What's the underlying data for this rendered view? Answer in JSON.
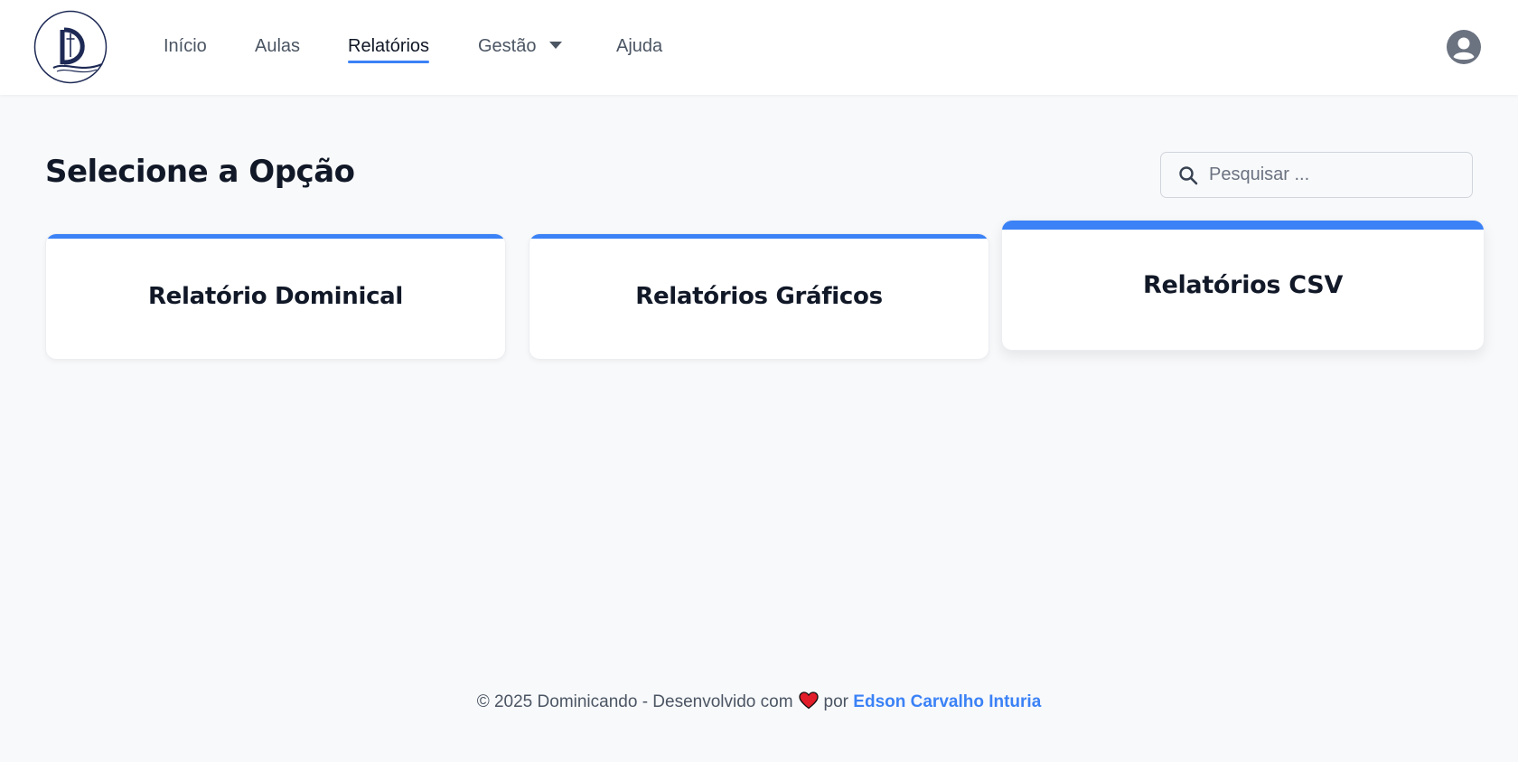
{
  "nav": {
    "items": [
      {
        "label": "Início",
        "active": false
      },
      {
        "label": "Aulas",
        "active": false
      },
      {
        "label": "Relatórios",
        "active": true
      },
      {
        "label": "Gestão",
        "active": false,
        "dropdown": true
      },
      {
        "label": "Ajuda",
        "active": false
      }
    ]
  },
  "icons": {
    "logo": "dominicando-logo",
    "dropdown": "caret-down-icon",
    "avatar": "user-circle-icon",
    "search": "search-icon",
    "heart": "heart-icon"
  },
  "main": {
    "title": "Selecione a Opção",
    "search": {
      "placeholder": "Pesquisar ...",
      "value": ""
    },
    "cards": [
      {
        "title": "Relatório Dominical"
      },
      {
        "title": "Relatórios Gráficos"
      },
      {
        "title": "Relatórios CSV",
        "hovered": true
      }
    ]
  },
  "footer": {
    "copyright": "© 2025 Dominicando - Desenvolvido com",
    "by": "por",
    "author": "Edson Carvalho Inturia"
  },
  "colors": {
    "accent": "#3b82f6",
    "logo_navy": "#1e2a55",
    "heart": "#e11d2a",
    "background": "#f8f9fb"
  }
}
